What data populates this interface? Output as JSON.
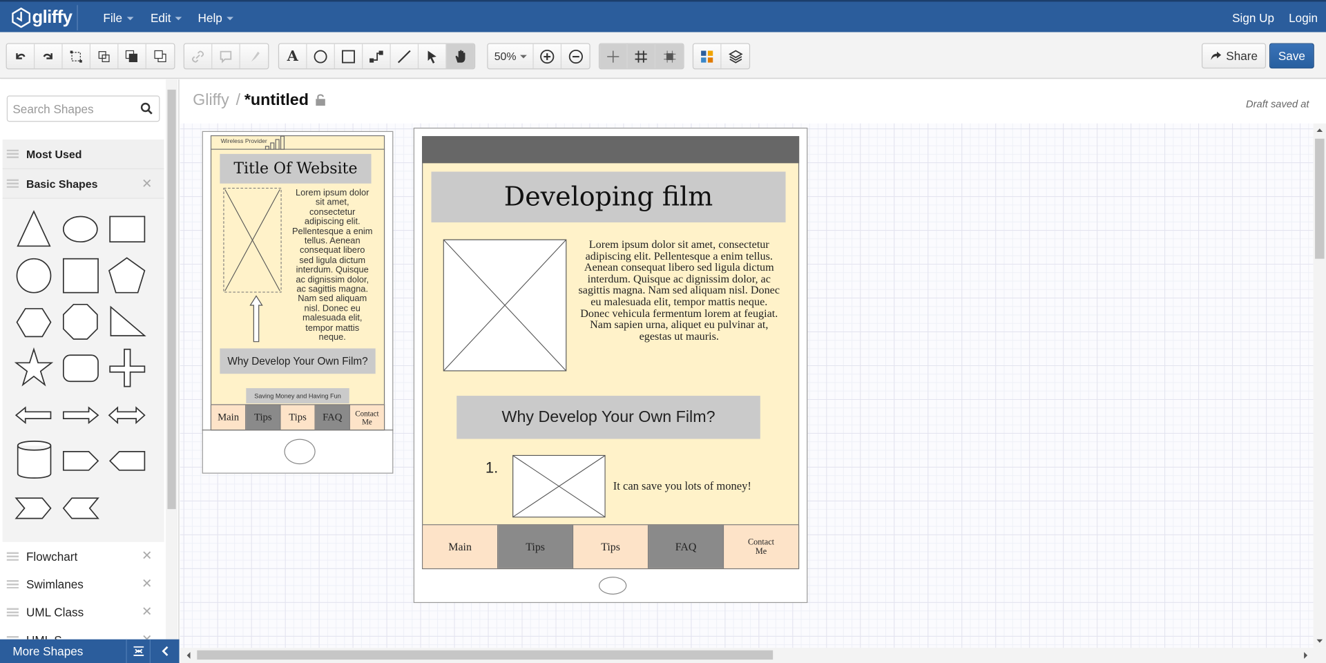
{
  "menubar": {
    "logo": "gliffy",
    "menus": [
      "File",
      "Edit",
      "Help"
    ],
    "sign_up": "Sign Up",
    "login": "Login"
  },
  "toolbar": {
    "zoom": "50%",
    "share": "Share",
    "save": "Save",
    "icons_edit": [
      "undo-icon",
      "redo-icon",
      "group-icon",
      "ungroup-icon",
      "bring-front-icon",
      "send-back-icon"
    ],
    "icons_link": [
      "link-icon",
      "comment-icon",
      "format-painter-icon"
    ],
    "icons_draw": [
      "text-tool-icon",
      "ellipse-tool-icon",
      "rectangle-tool-icon",
      "connector-tool-icon",
      "line-tool-icon",
      "pointer-tool-icon",
      "pan-tool-icon"
    ],
    "icons_view": [
      "guides-icon",
      "grid-icon",
      "snap-icon"
    ],
    "icons_theme": [
      "theme-icon",
      "layers-icon"
    ],
    "colors": {
      "brand": "#2b5d9c",
      "save": "#2f68ab"
    }
  },
  "sidebar": {
    "search_placeholder": "Search Shapes",
    "categories": [
      {
        "label": "Most Used"
      },
      {
        "label": "Basic Shapes"
      }
    ],
    "more_categories": [
      {
        "label": "Flowchart"
      },
      {
        "label": "Swimlanes"
      },
      {
        "label": "UML Class"
      },
      {
        "label": "UML S..."
      }
    ],
    "more_shapes": "More Shapes"
  },
  "document": {
    "breadcrumb_root": "Gliffy",
    "separator": "/",
    "title": "*untitled",
    "draft_status": "Draft saved at"
  },
  "phone_mockup": {
    "carrier": "Wireless Provider",
    "title": "Title Of Website",
    "body": "Lorem ipsum dolor sit amet, consectetur adipiscing elit. Pellentesque a enim tellus. Aenean consequat libero sed ligula dictum interdum. Quisque ac dignissim dolor, ac sagittis magna. Nam sed aliquam nisl. Donec eu malesuada elit, tempor mattis neque.",
    "button": "Why Develop Your Own Film?",
    "subtitle": "Saving Money and Having Fun",
    "nav": [
      "Main",
      "Tips",
      "Tips",
      "FAQ",
      "Contact Me"
    ]
  },
  "tablet_mockup": {
    "title": "Developing film",
    "body": "Lorem ipsum dolor sit amet, consectetur adipiscing elit. Pellentesque a enim tellus. Aenean consequat libero sed ligula dictum interdum. Quisque ac dignissim dolor, ac sagittis magna. Nam sed aliquam nisl. Donec eu malesuada elit, tempor mattis neque. Donec vehicula fermentum lorem at feugiat. Nam sapien urna, aliquet eu pulvinar at, egestas ut mauris.",
    "button": "Why Develop Your Own Film?",
    "list_number": "1.",
    "list_text": "It can save you lots of money!",
    "nav": [
      "Main",
      "Tips",
      "Tips",
      "FAQ",
      "Contact Me"
    ]
  }
}
